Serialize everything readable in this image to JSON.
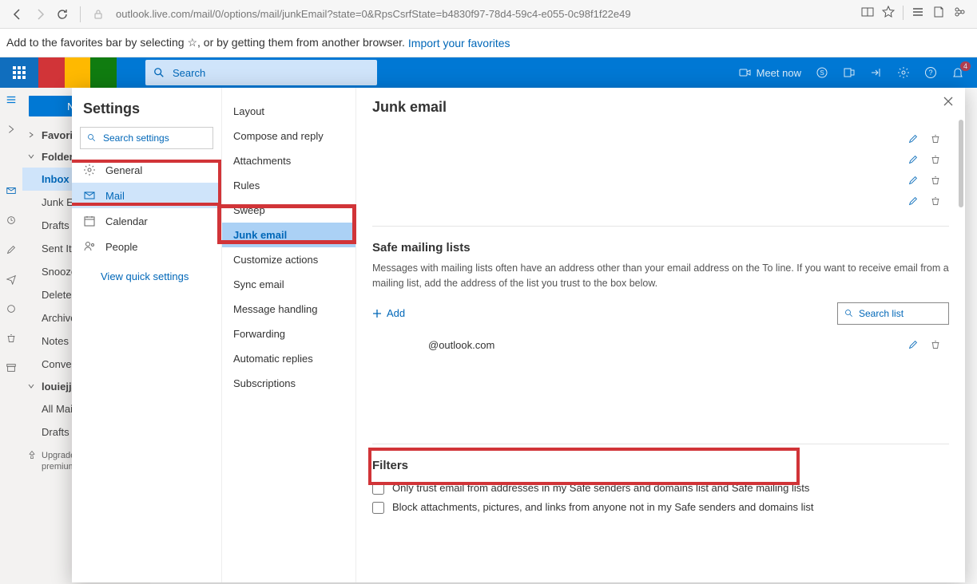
{
  "browser": {
    "url": "outlook.live.com/mail/0/options/mail/junkEmail?state=0&RpsCsrfState=b4830f97-78d4-59c4-e055-0c98f1f22e49"
  },
  "fav_bar": {
    "text": "Add to the favorites bar by selecting ☆, or by getting them from another browser. ",
    "link": "Import your favorites"
  },
  "outlook_header": {
    "search_placeholder": "Search",
    "meet_now": "Meet now",
    "notif_count": "4"
  },
  "sidebar": {
    "new_message": "New me",
    "favorites_label": "Favorites",
    "folders_label": "Folders",
    "items": [
      "Inbox",
      "Junk Em",
      "Drafts",
      "Sent Ite",
      "Snoozed",
      "Deleted",
      "Archive",
      "Notes",
      "Convers"
    ],
    "account_label": "louiejjar",
    "account_items": [
      "All Mai",
      "Drafts"
    ],
    "upgrade_text": "Upgrade Microsoft premium features"
  },
  "settings": {
    "title": "Settings",
    "search_placeholder": "Search settings",
    "categories": [
      {
        "icon": "gear",
        "label": "General"
      },
      {
        "icon": "mail",
        "label": "Mail"
      },
      {
        "icon": "cal",
        "label": "Calendar"
      },
      {
        "icon": "people",
        "label": "People"
      }
    ],
    "selected_category": 1,
    "quick_link": "View quick settings",
    "subitems": [
      "Layout",
      "Compose and reply",
      "Attachments",
      "Rules",
      "Sweep",
      "Junk email",
      "Customize actions",
      "Sync email",
      "Message handling",
      "Forwarding",
      "Automatic replies",
      "Subscriptions"
    ],
    "selected_sub": 5
  },
  "junk": {
    "title": "Junk email",
    "safe_lists": {
      "title": "Safe mailing lists",
      "desc": "Messages with mailing lists often have an address other than your email address on the To line. If you want to receive email from a mailing list, add the address of the list you trust to the box below.",
      "add_label": "Add",
      "search_placeholder": "Search list",
      "entry": "@outlook.com"
    },
    "filters": {
      "title": "Filters",
      "opt1": "Only trust email from addresses in my Safe senders and domains list and Safe mailing lists",
      "opt2": "Block attachments, pictures, and links from anyone not in my Safe senders and domains list"
    }
  }
}
